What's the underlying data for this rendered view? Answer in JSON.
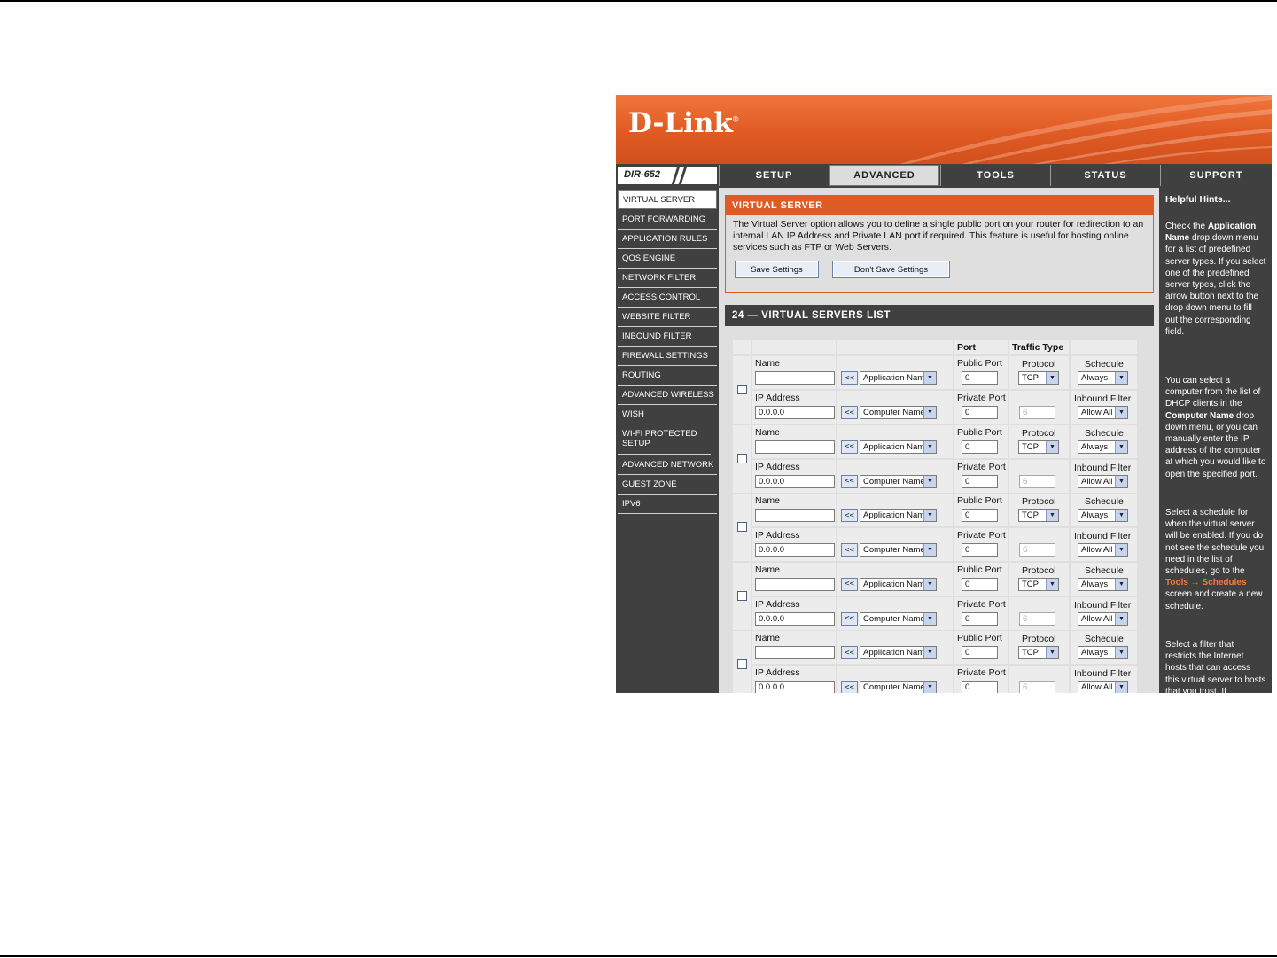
{
  "brand": {
    "logo": "D-Link",
    "model": "DIR-652",
    "trademark": "®"
  },
  "nav_tabs": [
    {
      "label": "SETUP"
    },
    {
      "label": "ADVANCED",
      "active": true
    },
    {
      "label": "TOOLS"
    },
    {
      "label": "STATUS"
    },
    {
      "label": "SUPPORT"
    }
  ],
  "sidebar": {
    "items": [
      {
        "label": "VIRTUAL SERVER",
        "active": true
      },
      {
        "label": "PORT FORWARDING"
      },
      {
        "label": "APPLICATION RULES"
      },
      {
        "label": "QOS ENGINE"
      },
      {
        "label": "NETWORK FILTER"
      },
      {
        "label": "ACCESS CONTROL"
      },
      {
        "label": "WEBSITE FILTER"
      },
      {
        "label": "INBOUND FILTER"
      },
      {
        "label": "FIREWALL SETTINGS"
      },
      {
        "label": "ROUTING"
      },
      {
        "label": "ADVANCED WIRELESS"
      },
      {
        "label": "WISH"
      },
      {
        "label": "WI-FI PROTECTED SETUP"
      },
      {
        "label": "ADVANCED NETWORK"
      },
      {
        "label": "GUEST ZONE"
      },
      {
        "label": "IPV6"
      }
    ]
  },
  "virtual_server": {
    "title": "VIRTUAL SERVER",
    "description": "The Virtual Server option allows you to define a single public port on your router for redirection to an internal LAN IP Address and Private LAN port if required. This feature is useful for hosting online services such as FTP or Web Servers.",
    "save_label": "Save Settings",
    "dont_save_label": "Don't Save Settings"
  },
  "list": {
    "title": "24 — VIRTUAL SERVERS LIST",
    "headers": {
      "port": "Port",
      "traffic_type": "Traffic Type"
    },
    "labels": {
      "name": "Name",
      "ip_address": "IP Address",
      "public_port": "Public Port",
      "private_port": "Private Port",
      "protocol": "Protocol",
      "schedule": "Schedule",
      "inbound_filter": "Inbound Filter",
      "arrow": "<<"
    },
    "rows": [
      {
        "name": "",
        "ip": "0.0.0.0",
        "app_select": "Application Nam",
        "computer_select": "Computer Name",
        "public_port": "0",
        "private_port": "0",
        "protocol": "TCP",
        "protocol_num": "6",
        "schedule": "Always",
        "inbound": "Allow All"
      },
      {
        "name": "",
        "ip": "0.0.0.0",
        "app_select": "Application Nam",
        "computer_select": "Computer Name",
        "public_port": "0",
        "private_port": "0",
        "protocol": "TCP",
        "protocol_num": "6",
        "schedule": "Always",
        "inbound": "Allow All"
      },
      {
        "name": "",
        "ip": "0.0.0.0",
        "app_select": "Application Nam",
        "computer_select": "Computer Name",
        "public_port": "0",
        "private_port": "0",
        "protocol": "TCP",
        "protocol_num": "6",
        "schedule": "Always",
        "inbound": "Allow All"
      },
      {
        "name": "",
        "ip": "0.0.0.0",
        "app_select": "Application Nam",
        "computer_select": "Computer Name",
        "public_port": "0",
        "private_port": "0",
        "protocol": "TCP",
        "protocol_num": "6",
        "schedule": "Always",
        "inbound": "Allow All"
      },
      {
        "name": "",
        "ip": "0.0.0.0",
        "app_select": "Application Nam",
        "computer_select": "Computer Name",
        "public_port": "0",
        "private_port": "0",
        "protocol": "TCP",
        "protocol_num": "6",
        "schedule": "Always",
        "inbound": "Allow All"
      }
    ]
  },
  "hints": {
    "title": "Helpful Hints...",
    "p1_pre": "Check the ",
    "p1_bold": "Application Name",
    "p1_post": " drop down menu for a list of predefined server types. If you select one of the predefined server types, click the arrow button next to the drop down menu to fill out the corresponding field.",
    "p2_pre": "You can select a computer from the list of DHCP clients in the ",
    "p2_bold": "Computer Name",
    "p2_post": " drop down menu, or you can manually enter the IP address of the computer at which you would like to open the specified port.",
    "p3_pre": "Select a schedule for when the virtual server will be enabled. If you do not see the schedule you need in the list of schedules, go to the ",
    "p3_link": "Tools → Schedules",
    "p3_post": " screen and create a new schedule.",
    "p4": "Select a filter that restricts the Internet hosts that can access this virtual server to hosts that you trust. If"
  },
  "colors": {
    "accent": "#e05a23",
    "dark": "#404040",
    "panel": "#dfdfdf"
  }
}
